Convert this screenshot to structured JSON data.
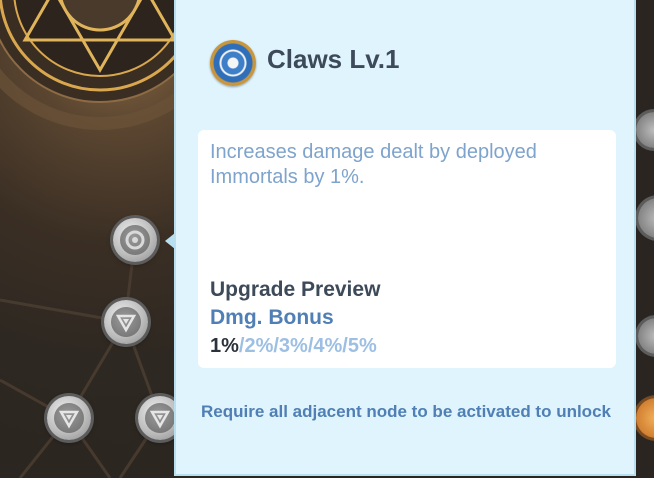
{
  "skill": {
    "icon": "claw-skill-icon",
    "title": "Claws Lv.1",
    "description": "Increases damage dealt by deployed Immortals by 1%.",
    "preview_heading": "Upgrade Preview",
    "bonus_label": "Dmg. Bonus",
    "current_level_value": "1%",
    "upcoming_level_values": "/2%/3%/4%/5%",
    "requirement": "Require all adjacent node to be activated to unlock"
  },
  "colors": {
    "panel_bg": "#dff4fc",
    "title": "#3d4a59",
    "description": "#7ea3cc",
    "accent_blue": "#4f7fb5",
    "upcoming_values": "#9dbfe3"
  }
}
